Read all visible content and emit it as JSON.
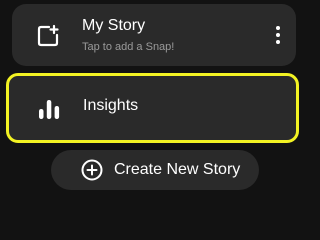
{
  "my_story": {
    "title": "My Story",
    "subtitle": "Tap to add a Snap!",
    "icon": "add-snap-icon",
    "menu_icon": "more-vertical-icon"
  },
  "insights": {
    "label": "Insights",
    "icon": "bar-chart-icon",
    "highlight_color": "#f3f323"
  },
  "create_story": {
    "label": "Create New Story",
    "icon": "plus-circle-icon"
  },
  "colors": {
    "background": "#121212",
    "card": "#2a2a2a",
    "text": "#ffffff",
    "subtext": "#9a9a9a",
    "highlight": "#f3f323"
  }
}
